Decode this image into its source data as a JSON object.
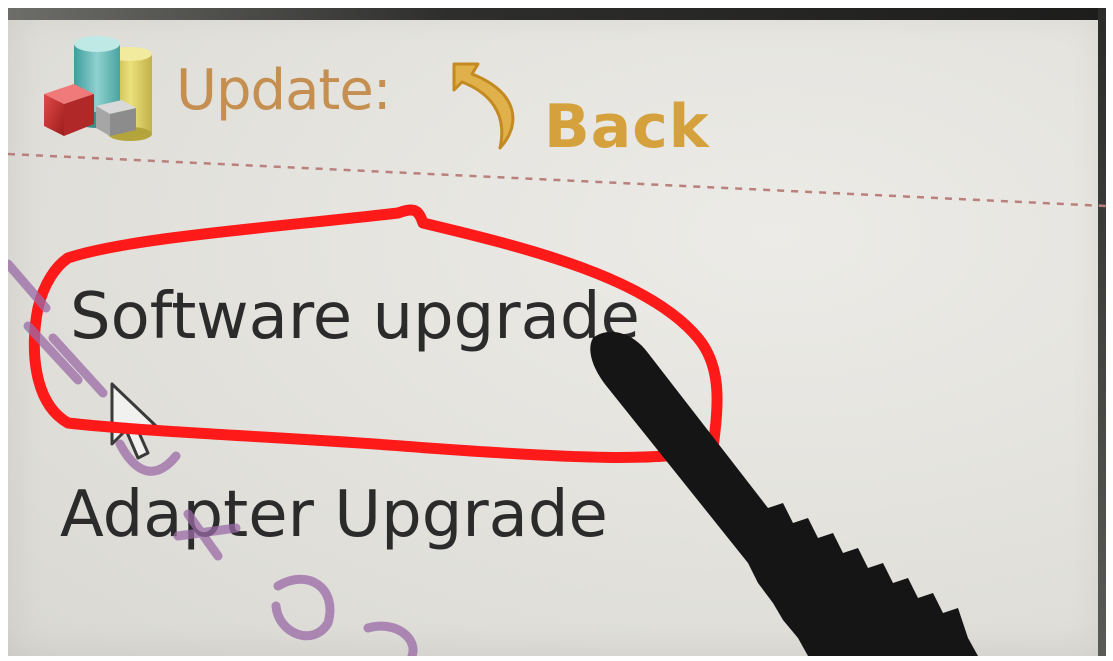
{
  "header": {
    "title": "Update:",
    "back_label": "Back",
    "icons": {
      "update": "database-update-icon",
      "back": "back-arrow-icon"
    }
  },
  "menu": {
    "items": [
      {
        "label": "Software upgrade",
        "highlighted": true
      },
      {
        "label": "Adapter Upgrade",
        "highlighted": false
      }
    ]
  },
  "annotations": {
    "highlight_color": "#ff1a1a",
    "pointer_icon": "mouse-pointer-icon",
    "stylus_icon": "stylus-pen-icon"
  },
  "colors": {
    "title": "#c48f50",
    "back": "#d4a13d",
    "divider": "#b9807c",
    "menu_text": "#2b2b2b",
    "screen_bg": "#e4e3de"
  }
}
